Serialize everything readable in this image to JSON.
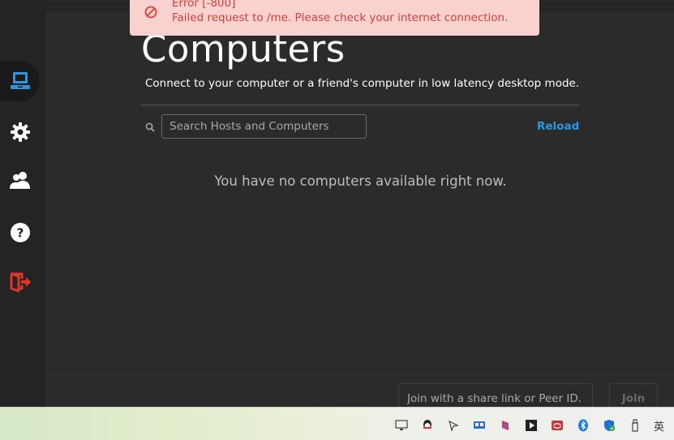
{
  "page": {
    "title": "Computers",
    "subtitle": "Connect to your computer or a friend's computer in low latency desktop mode.",
    "empty_message": "You have no computers available right now."
  },
  "search": {
    "placeholder": "Search Hosts and Computers",
    "value": ""
  },
  "toolbar": {
    "reload_label": "Reload"
  },
  "toast": {
    "title": "Error [-800]",
    "message": "Failed request to /me. Please check your internet connection.",
    "color": "#d0403a",
    "background": "#f9d2d0"
  },
  "footer": {
    "join_placeholder": "Join with a share link or Peer ID.",
    "join_label": "Join"
  },
  "sidebar": {
    "items": [
      {
        "icon": "computer-icon",
        "active": true
      },
      {
        "icon": "gear-icon",
        "active": false
      },
      {
        "icon": "users-icon",
        "active": false
      },
      {
        "icon": "help-icon",
        "active": false
      },
      {
        "icon": "logout-icon",
        "active": false
      }
    ]
  },
  "taskbar": {
    "language": "英"
  },
  "colors": {
    "accent": "#2c97e0",
    "logout": "#e0352b",
    "background": "#2b2b2b",
    "sidebar": "#242424"
  }
}
